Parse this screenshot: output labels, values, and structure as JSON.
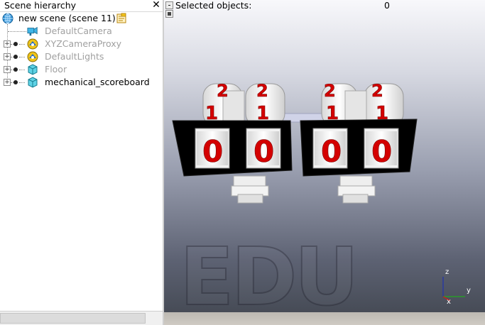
{
  "panel": {
    "title": "Scene hierarchy",
    "close_glyph": "✕"
  },
  "tree": {
    "root": {
      "label": "new scene (scene 11)",
      "icon": "globe-icon"
    },
    "items": [
      {
        "label": "DefaultCamera",
        "icon": "camera-icon",
        "dimmed": true,
        "expandable": false
      },
      {
        "label": "XYZCameraProxy",
        "icon": "camera-proxy-icon",
        "dimmed": true,
        "expandable": true
      },
      {
        "label": "DefaultLights",
        "icon": "lights-icon",
        "dimmed": true,
        "expandable": true
      },
      {
        "label": "Floor",
        "icon": "cube-icon",
        "dimmed": true,
        "expandable": true
      },
      {
        "label": "mechanical_scoreboard",
        "icon": "cube-icon",
        "dimmed": false,
        "expandable": true
      }
    ],
    "expander_glyph": "+"
  },
  "viewport": {
    "selected_label": "Selected objects:",
    "selected_count": "0",
    "watermark": "EDU",
    "axes": {
      "z": "z",
      "y": "y",
      "x": "x"
    },
    "scoreboard": {
      "digits_front": [
        "0",
        "0",
        "0",
        "0"
      ],
      "digits_mid": [
        "1",
        "1",
        "1",
        "1"
      ],
      "digits_top": [
        "2",
        "2",
        "2",
        "2"
      ]
    },
    "colors": {
      "digit": "#d40000",
      "board": "#000000"
    }
  }
}
